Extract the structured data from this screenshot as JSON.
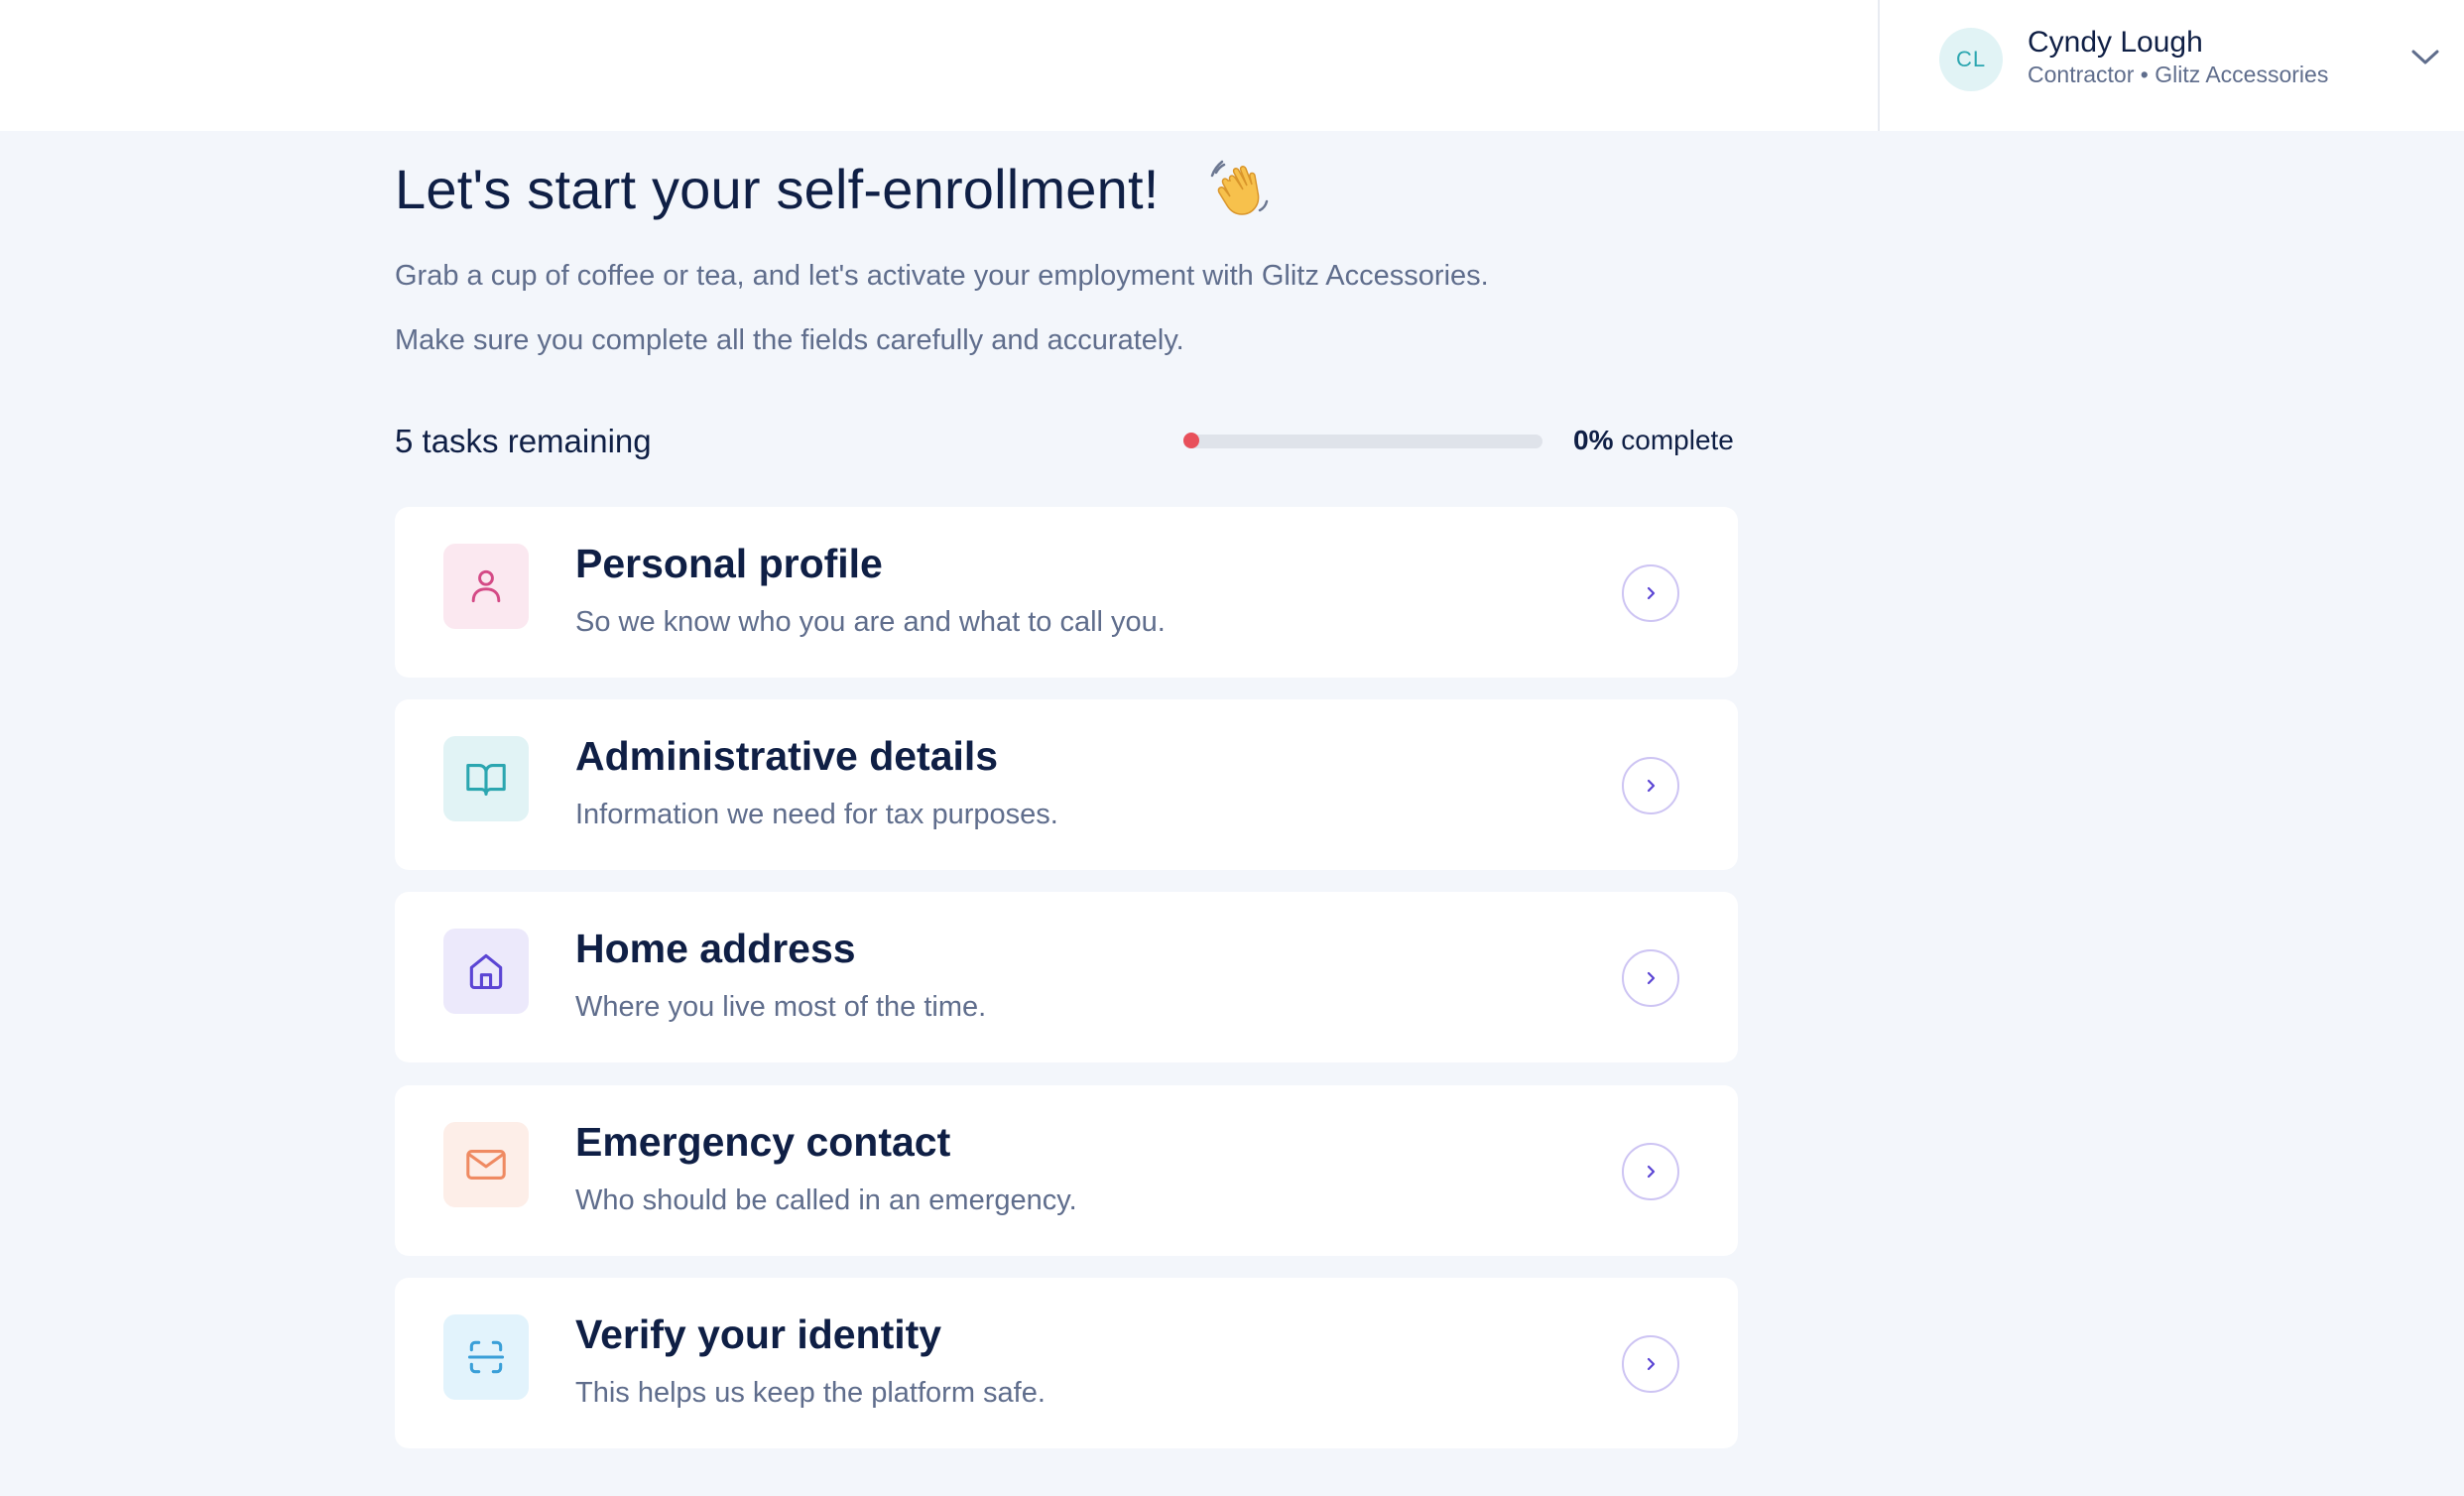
{
  "header": {
    "user": {
      "initials": "CL",
      "name": "Cyndy Lough",
      "role": "Contractor • Glitz Accessories"
    },
    "menu_icon": "chevron-down-icon"
  },
  "main": {
    "title": "Let's start your self-enrollment!",
    "title_emoji_icon": "waving-hand-icon",
    "intro_line_1": "Grab a cup of coffee or tea, and let's activate your employment with Glitz Accessories.",
    "intro_line_2": "Make sure you complete all the fields carefully and accurately.",
    "tasks_remaining": "5 tasks remaining",
    "progress": {
      "percent_label": "0%",
      "suffix": "complete",
      "value": 0,
      "indicator_color": "#e8505b"
    },
    "tasks": [
      {
        "title": "Personal profile",
        "description": "So we know who you are and what to call you.",
        "icon": "user-icon",
        "icon_color": "#d44a86",
        "icon_bg": "#fbe8f0"
      },
      {
        "title": "Administrative details",
        "description": "Information we need for tax purposes.",
        "icon": "book-open-icon",
        "icon_color": "#2ba6b0",
        "icon_bg": "#e1f3f5"
      },
      {
        "title": "Home address",
        "description": "Where you live most of the time.",
        "icon": "home-icon",
        "icon_color": "#5b45d4",
        "icon_bg": "#ece9fb"
      },
      {
        "title": "Emergency contact",
        "description": "Who should be called in an emergency.",
        "icon": "mail-icon",
        "icon_color": "#ef8a62",
        "icon_bg": "#fdeee8"
      },
      {
        "title": "Verify your identity",
        "description": "This helps us keep the platform safe.",
        "icon": "scan-icon",
        "icon_color": "#3a9fd8",
        "icon_bg": "#e2f3fc"
      }
    ],
    "arrow_icon": "chevron-right-icon",
    "arrow_color": "#5b45d4"
  }
}
